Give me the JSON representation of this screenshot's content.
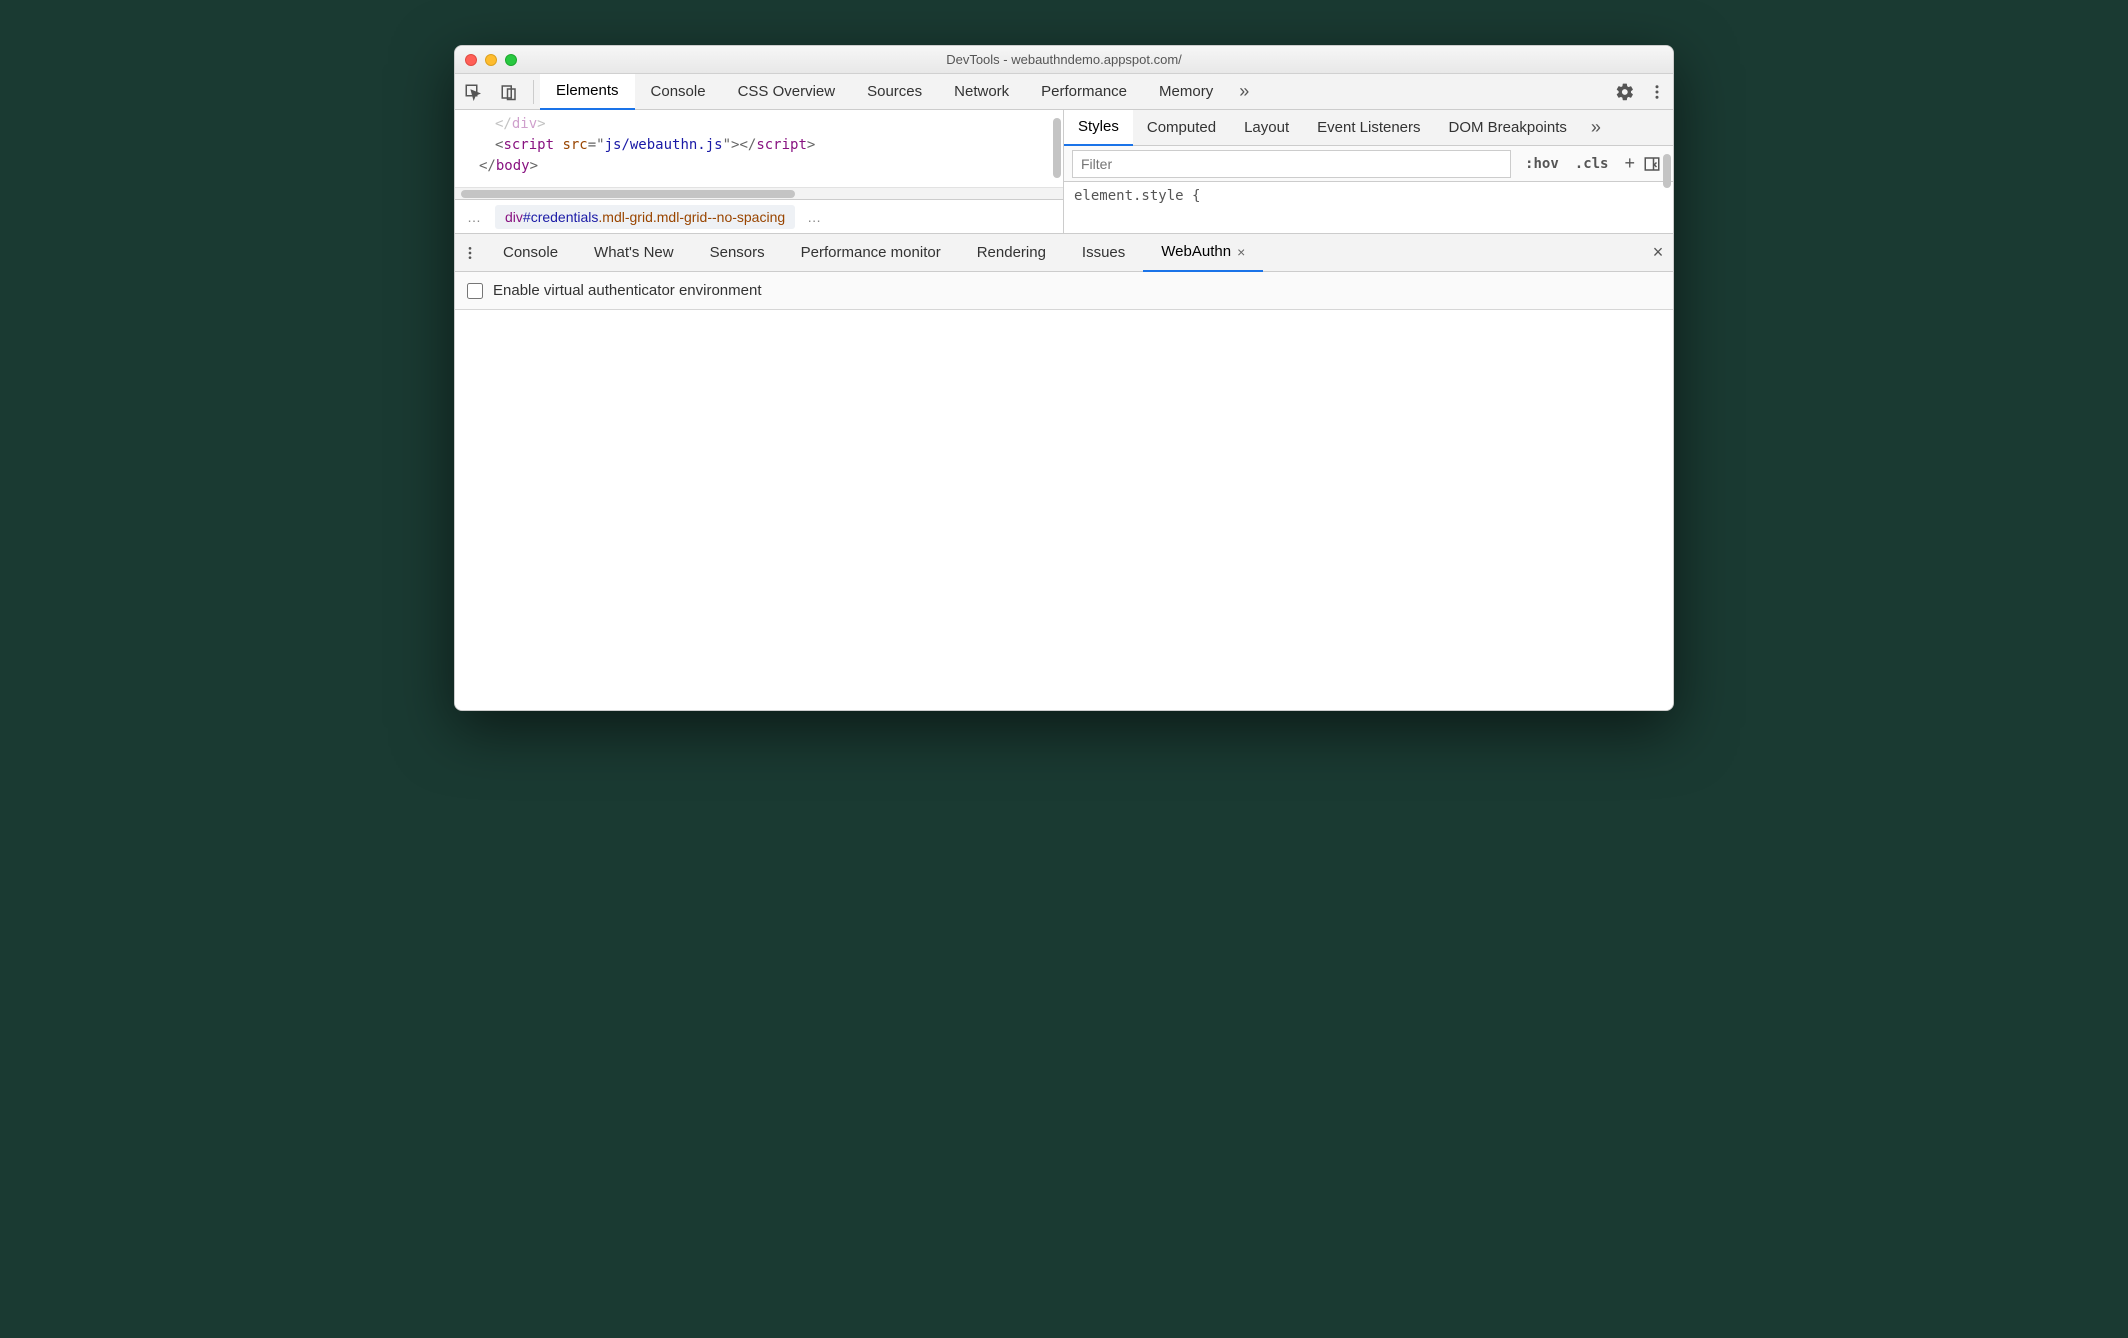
{
  "titlebar": {
    "title": "DevTools - webauthndemo.appspot.com/"
  },
  "main_tabs": {
    "items": [
      "Elements",
      "Console",
      "CSS Overview",
      "Sources",
      "Network",
      "Performance",
      "Memory"
    ],
    "active": 0,
    "overflow_glyph": "»"
  },
  "dom": {
    "line0_frag0": "</",
    "line0_frag1": "div",
    "line0_frag2": ">",
    "line1_frag0": "<",
    "line1_frag1": "script",
    "line1_frag2": " src",
    "line1_frag3": "=\"",
    "line1_frag4": "js/webauthn.js",
    "line1_frag5": "\">",
    "line1_frag6": "</",
    "line1_frag7": "script",
    "line1_frag8": ">",
    "line2_frag0": "</",
    "line2_frag1": "body",
    "line2_frag2": ">"
  },
  "breadcrumb": {
    "ellipsis": "…",
    "tag": "div",
    "id": "#credentials",
    "c1": ".mdl-grid",
    "c2": ".mdl-grid--no-spacing",
    "trailing": "…"
  },
  "styles": {
    "tabs": [
      "Styles",
      "Computed",
      "Layout",
      "Event Listeners",
      "DOM Breakpoints"
    ],
    "active": 0,
    "overflow_glyph": "»",
    "filter_placeholder": "Filter",
    "hov": ":hov",
    "cls": ".cls",
    "element_style": "element.style {"
  },
  "drawer": {
    "tabs": [
      "Console",
      "What's New",
      "Sensors",
      "Performance monitor",
      "Rendering",
      "Issues",
      "WebAuthn"
    ],
    "active": 6,
    "close_glyph": "×"
  },
  "webauthn": {
    "checkbox_label": "Enable virtual authenticator environment"
  }
}
